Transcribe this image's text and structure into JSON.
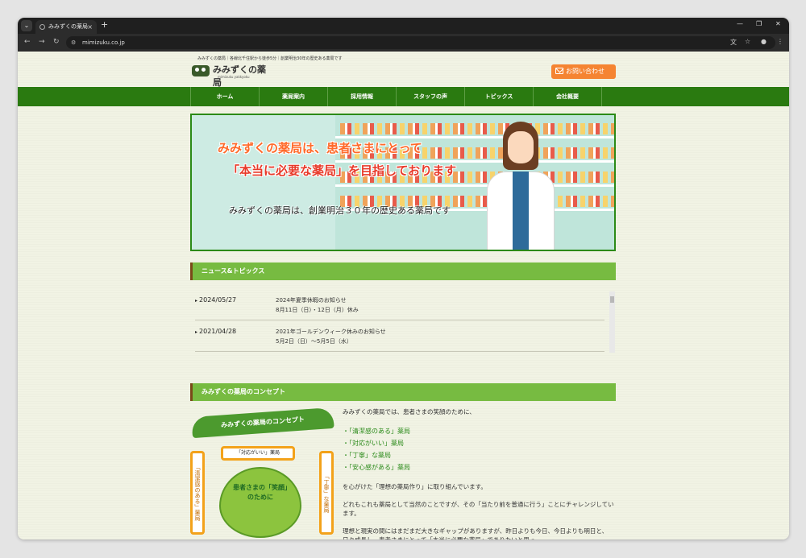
{
  "browser": {
    "tab_title": "みみずくの薬局",
    "tab_close": "×",
    "new_tab": "+",
    "url": "mimizuku.co.jp",
    "window_controls": [
      "—",
      "❐",
      "✕"
    ]
  },
  "site": {
    "tagline": "みみずくの薬局｜各線北千住駅から徒歩5分｜創業明治30年の歴史ある薬局です",
    "logo_name": "みみずくの薬局",
    "logo_roman": "mimizuku yakkyoku",
    "contact_label": "お問い合わせ"
  },
  "nav": {
    "items": [
      "ホーム",
      "薬局案内",
      "採用情報",
      "スタッフの声",
      "トピックス",
      "会社概要"
    ]
  },
  "hero": {
    "line1": "みみずくの薬局は、患者さまにとって",
    "line2": "「本当に必要な薬局」を目指しております",
    "line3": "みみずくの薬局は、創業明治３０年の歴史ある薬局です"
  },
  "news": {
    "heading": "ニュース&トピックス",
    "items": [
      {
        "date": "2024/05/27",
        "title": "2024年夏季休暇のお知らせ",
        "sub": "8月11日（日）・12日（月）休み"
      },
      {
        "date": "2021/04/28",
        "title": "2021年ゴールデンウィーク休みのお知らせ",
        "sub": "5月2日（日）〜5月5日（水）"
      }
    ]
  },
  "concept": {
    "heading": "みみずくの薬局のコンセプト",
    "ribbon": "みみずくの薬局のコンセプト",
    "box_top": "「対応がいい」薬局",
    "box_left": "「清潔感のある」薬局",
    "box_right": "「丁寧」な薬局",
    "leaf_text": "患者さまの「笑顔」のために",
    "intro": "みみずくの薬局では、患者さまの笑顔のために、",
    "points": [
      "・「清潔感のある」薬局",
      "・「対応がいい」薬局",
      "・「丁寧」な薬局",
      "・「安心感がある」薬局"
    ],
    "p2": "を心がけた「理想の薬局作り」に取り組んでいます。",
    "p3": "どれもこれも薬局として当然のことですが、その「当たり前を普通に行う」ことにチャレンジしています。",
    "p4": "理想と現実の間にはまだまだ大きなギャップがありますが、昨日よりも今日、今日よりも明日と、日々成長し、患者さまにとって「本当に必要な薬局」でありたいと思っ"
  }
}
